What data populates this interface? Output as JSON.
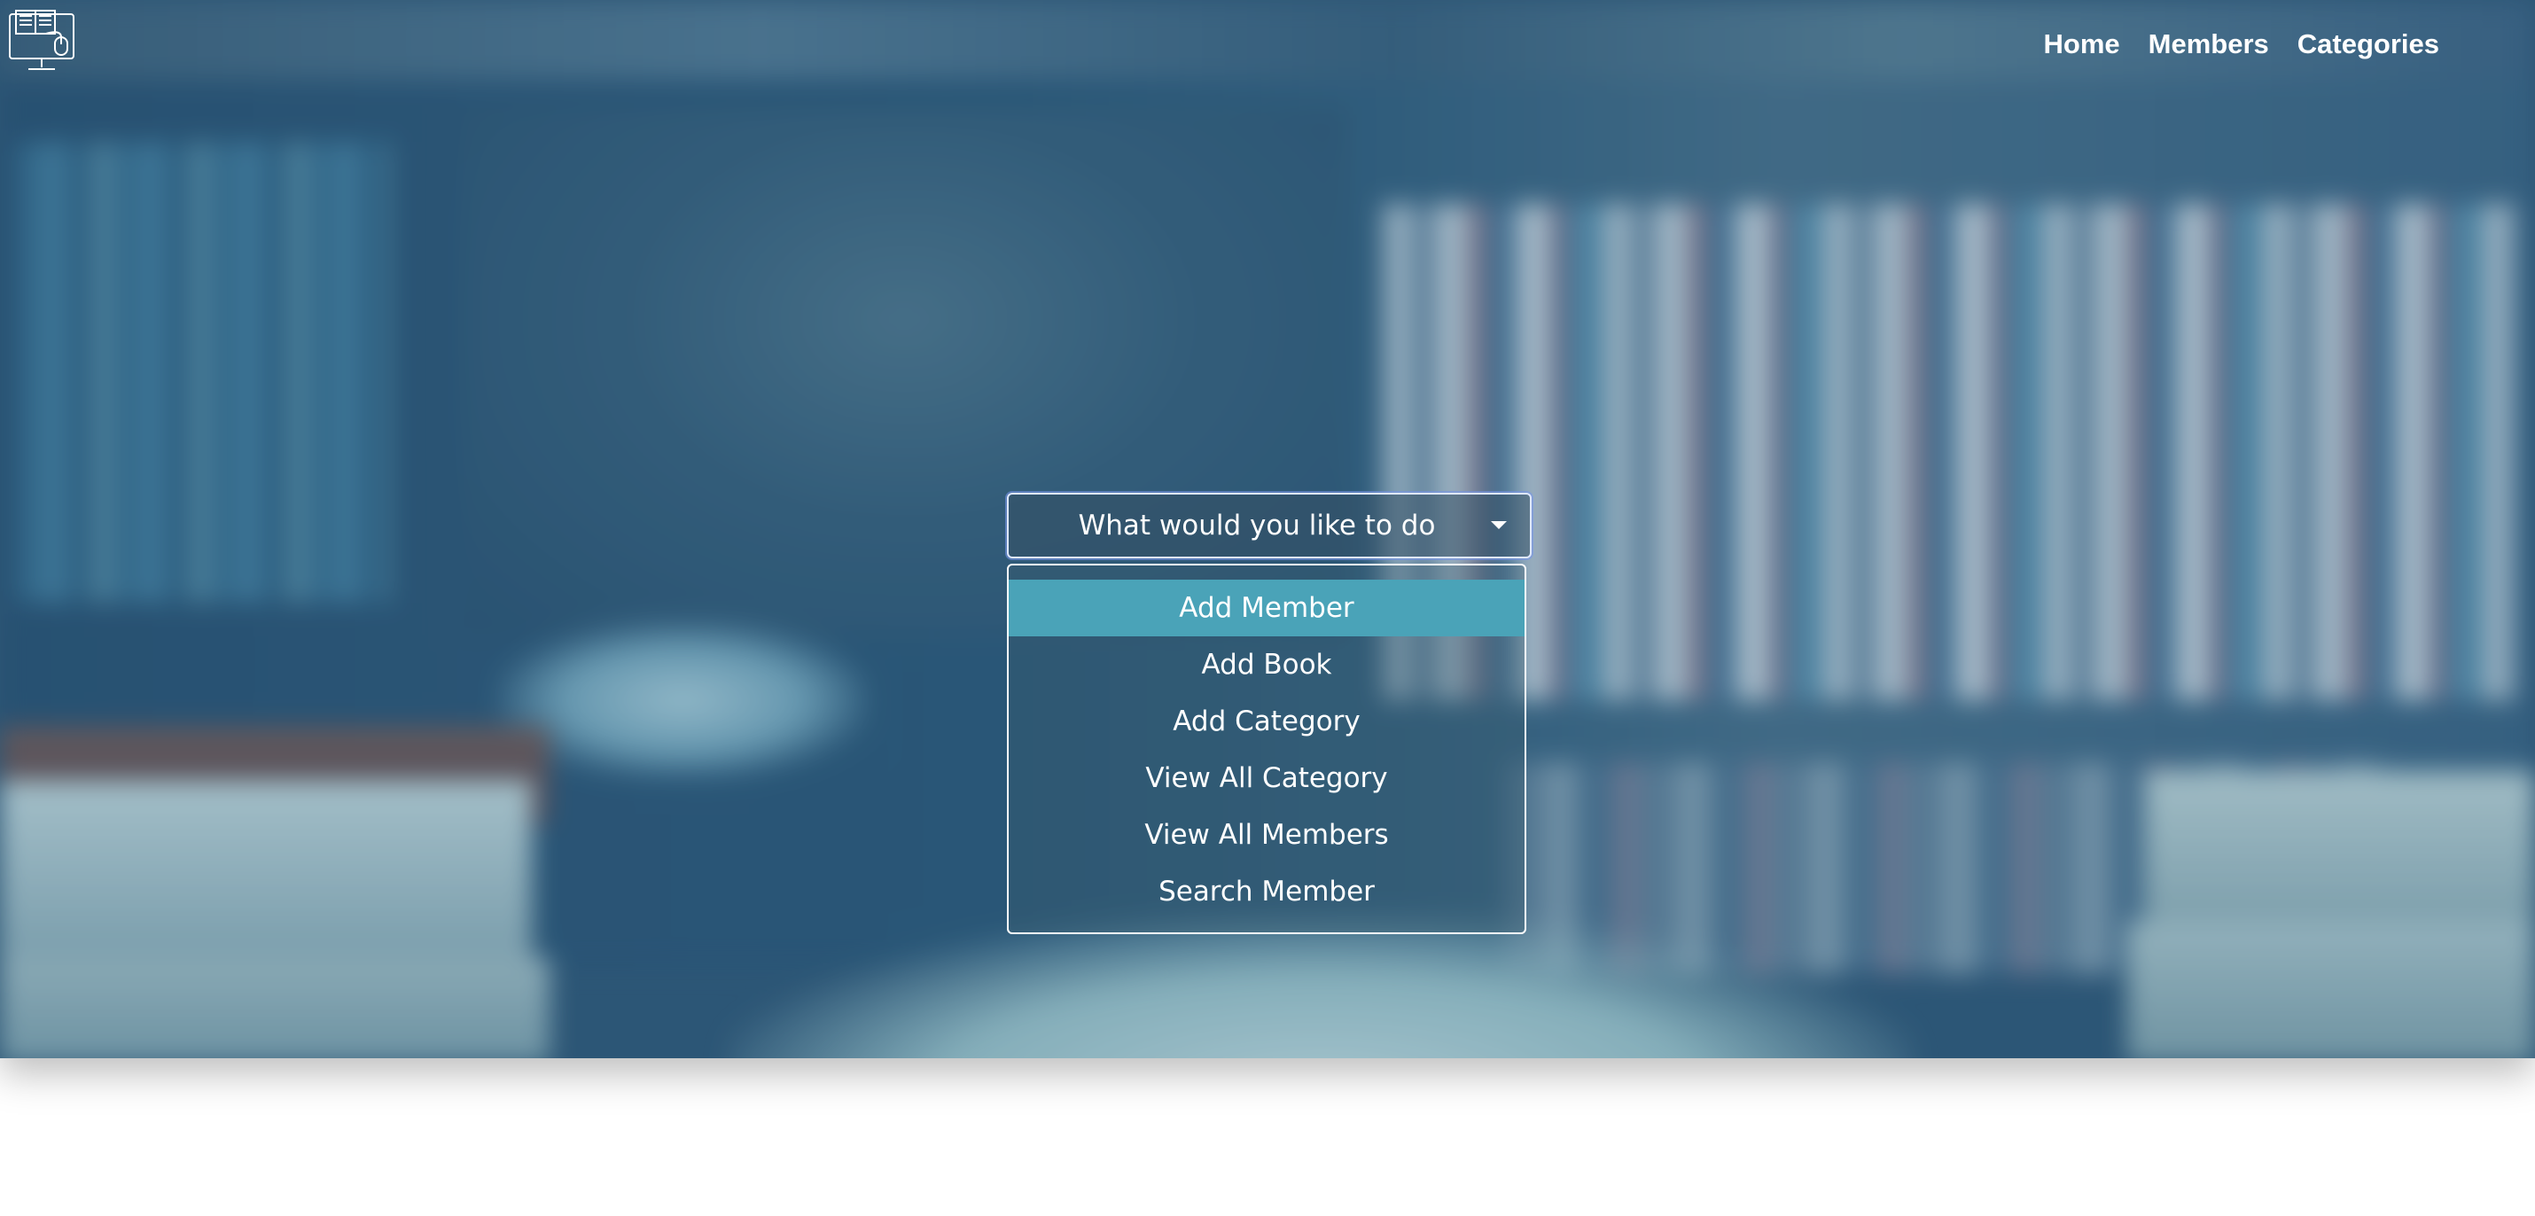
{
  "nav": {
    "logo_icon": "computer-books-logo-icon",
    "items": [
      {
        "label": "Home"
      },
      {
        "label": "Members"
      },
      {
        "label": "Categories"
      }
    ]
  },
  "action_select": {
    "placeholder": "What would you like to do",
    "options": [
      {
        "label": "Add Member",
        "highlighted": true
      },
      {
        "label": "Add Book"
      },
      {
        "label": "Add Category"
      },
      {
        "label": "View All Category"
      },
      {
        "label": "View All Members"
      },
      {
        "label": "Search Member"
      }
    ]
  },
  "colors": {
    "highlight": "#4aa3b8",
    "text": "#ffffff",
    "overlay_tint": "#285a82"
  }
}
